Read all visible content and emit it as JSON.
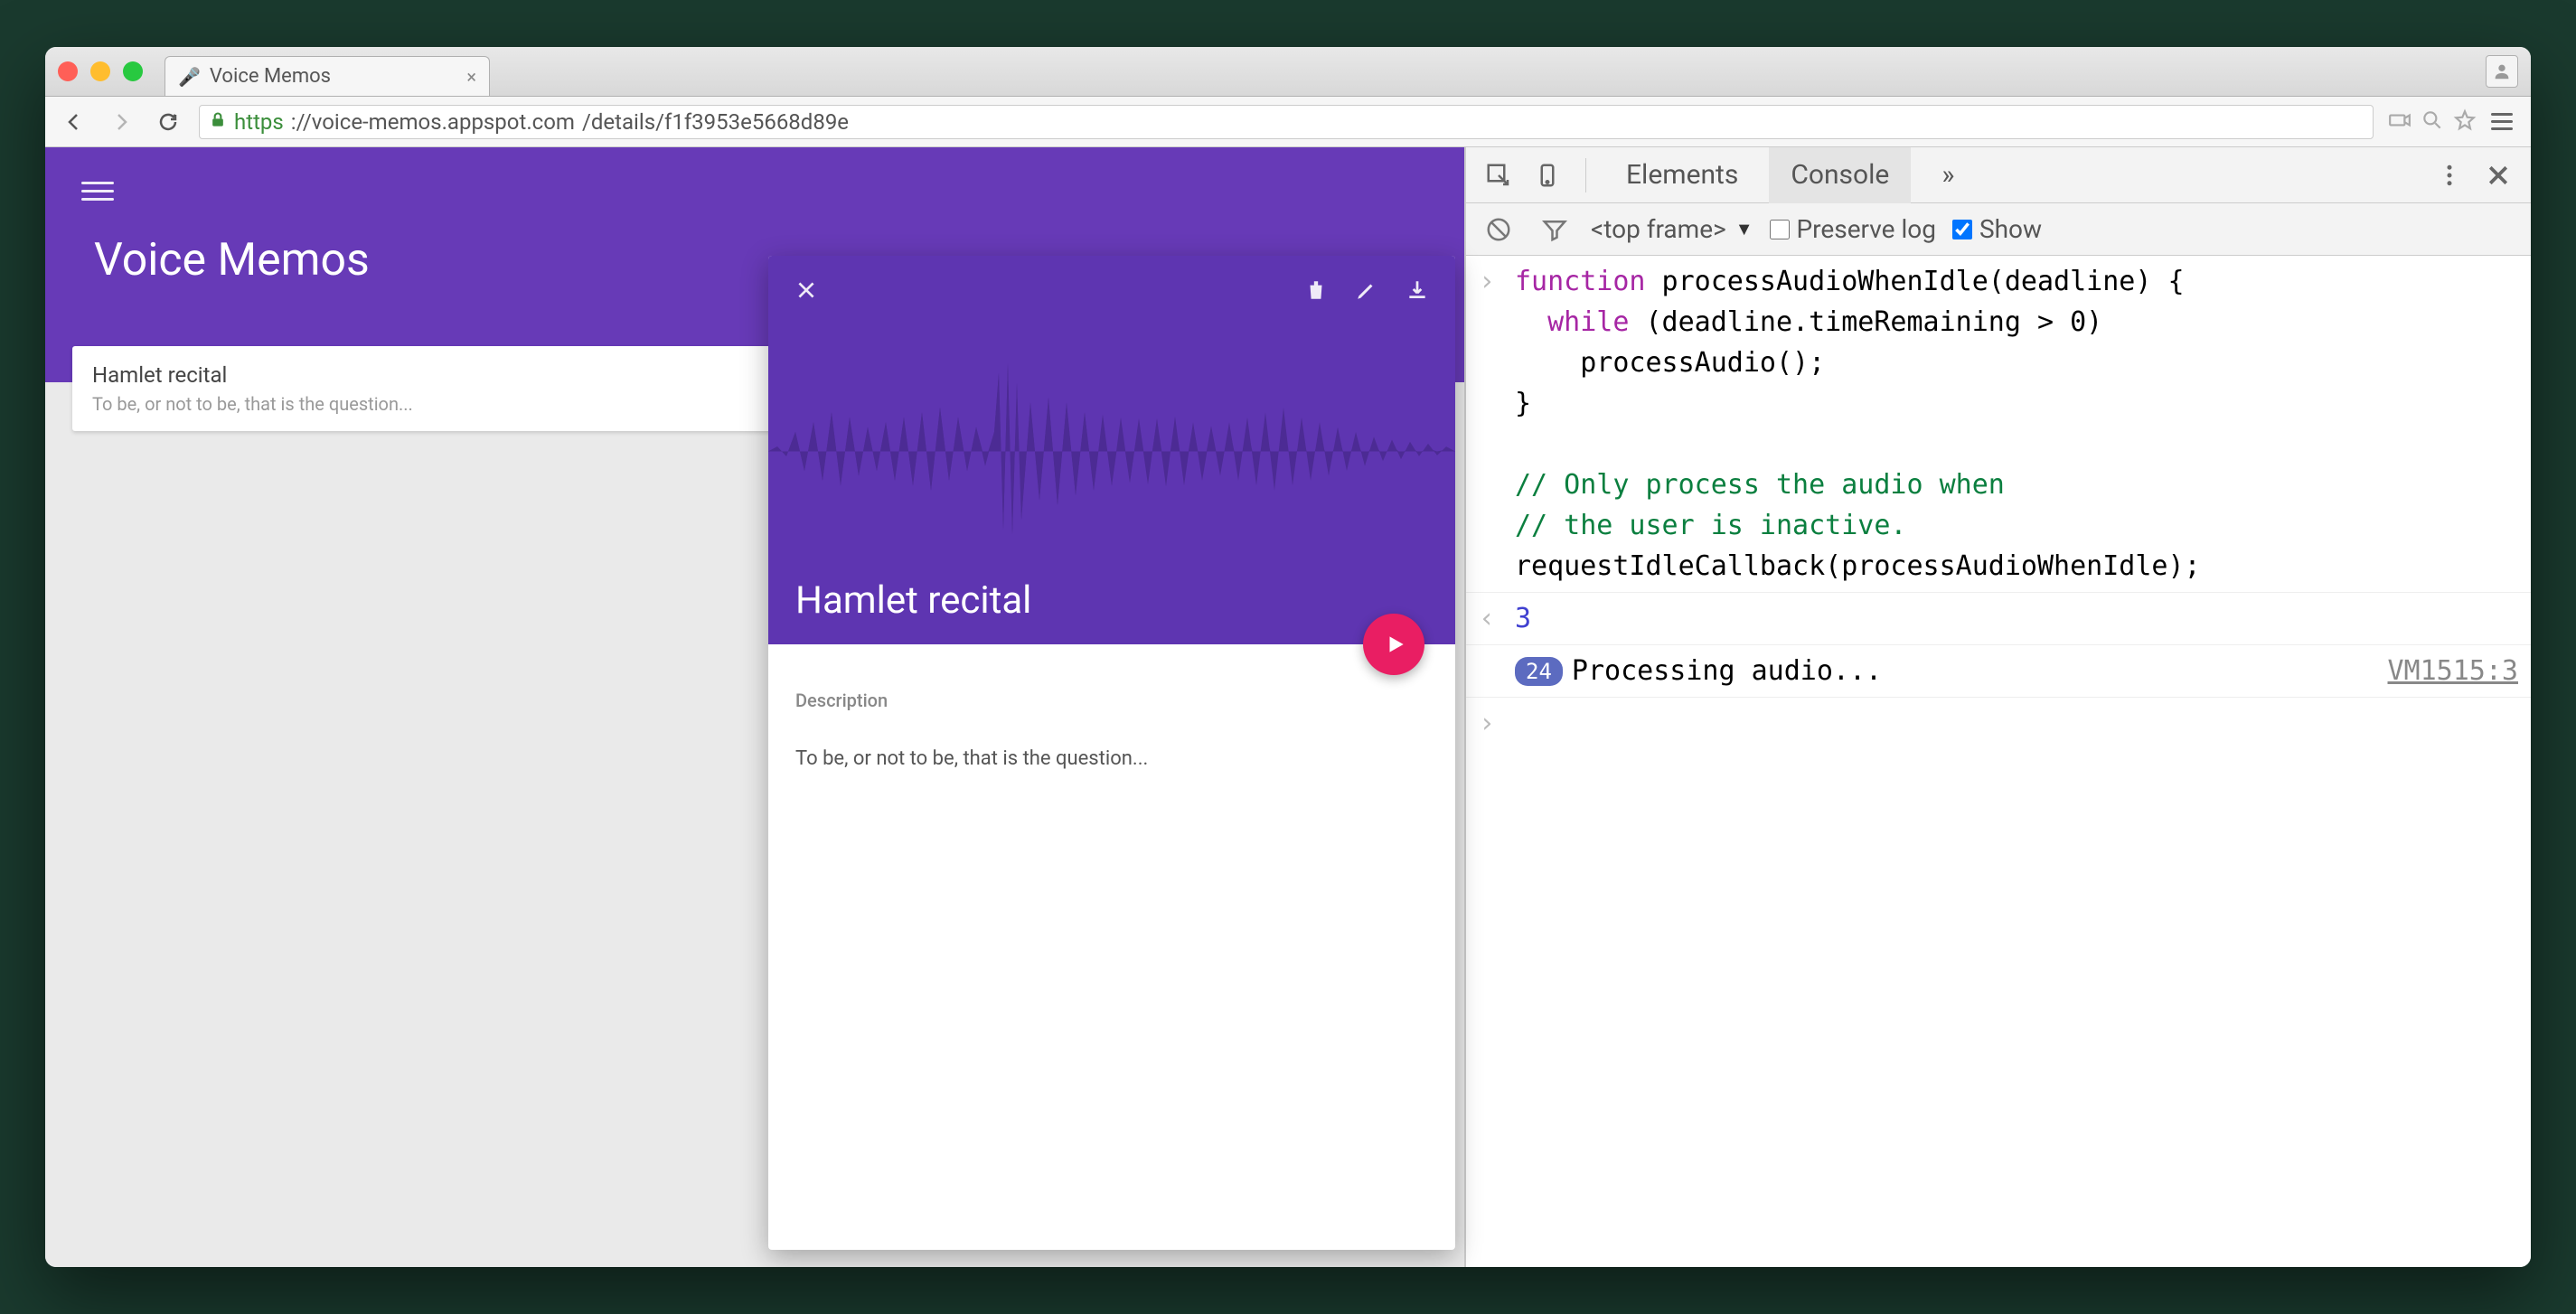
{
  "browser": {
    "tab_title": "Voice Memos",
    "url_scheme": "https",
    "url_host": "://voice-memos.appspot.com",
    "url_path": "/details/f1f3953e5668d89e"
  },
  "app": {
    "title": "Voice Memos",
    "memo": {
      "title": "Hamlet recital",
      "subtitle": "To be, or not to be, that is the question..."
    },
    "detail": {
      "title": "Hamlet recital",
      "description_label": "Description",
      "description_text": "To be, or not to be, that is the question..."
    }
  },
  "devtools": {
    "tabs": {
      "elements": "Elements",
      "console": "Console",
      "more": "»"
    },
    "controls": {
      "frame": "<top frame>",
      "preserve_log": "Preserve log",
      "show": "Show"
    },
    "console": {
      "code_line1": "function processAudioWhenIdle(deadline) {",
      "code_line1_kw": "function",
      "code_line1_rest": " processAudioWhenIdle(deadline) {",
      "code_line2_kw": "while",
      "code_line2_rest": " (deadline.timeRemaining > 0)",
      "code_line3": "    processAudio();",
      "code_line4": "}",
      "code_blank": "",
      "code_cmt1": "// Only process the audio when",
      "code_cmt2": "// the user is inactive.",
      "code_line5": "requestIdleCallback(processAudioWhenIdle);",
      "return_val": "3",
      "log_count": "24",
      "log_msg": "Processing audio...",
      "log_source": "VM1515:3"
    }
  }
}
